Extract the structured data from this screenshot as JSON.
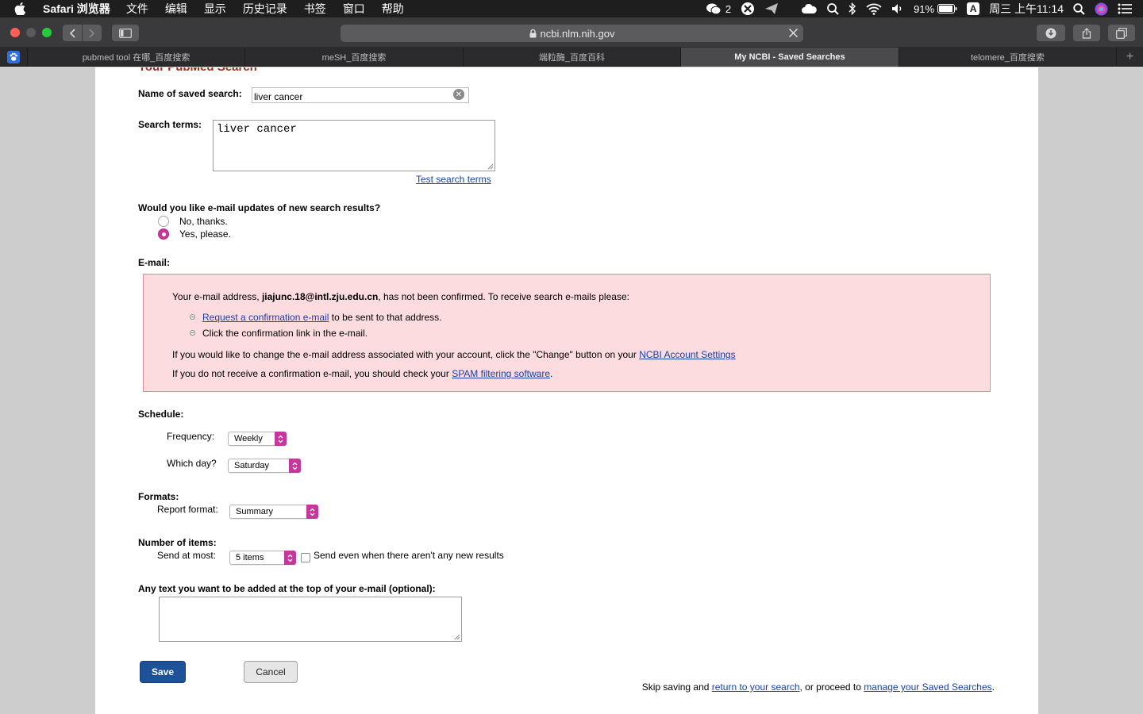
{
  "menubar": {
    "app_name": "Safari 浏览器",
    "items": [
      "文件",
      "编辑",
      "显示",
      "历史记录",
      "书签",
      "窗口",
      "帮助"
    ],
    "wechat_count": "2",
    "battery": "91%",
    "input_method": "A",
    "clock": "周三 上午11:14"
  },
  "browser": {
    "url": "ncbi.nlm.nih.gov",
    "tabs": [
      "pubmed tool 在哪_百度搜索",
      "meSH_百度搜索",
      "端粒酶_百度百科",
      "My NCBI - Saved Searches",
      "telomere_百度搜索"
    ],
    "new_tab_glyph": "+"
  },
  "form": {
    "heading_cut": "Your PubMed Search",
    "name_label": "Name of saved search:",
    "name_value": "liver cancer",
    "terms_label": "Search terms:",
    "terms_value": "liver cancer",
    "test_link": "Test search terms",
    "email_question": "Would you like e-mail updates of new search results?",
    "radio_no": "No, thanks.",
    "radio_yes": "Yes, please.",
    "email_label": "E-mail:",
    "notice": {
      "line1_pre": "Your e-mail address, ",
      "line1_email": "jiajunc.18@intl.zju.edu.cn",
      "line1_post": ", has not been confirmed. To receive search e-mails please:",
      "bullet1_link": "Request a confirmation e-mail",
      "bullet1_post": " to be sent to that address.",
      "bullet2": "Click the confirmation link in the e-mail.",
      "line3_pre": "If you would like to change the e-mail address associated with your account, click the \"Change\" button on your ",
      "line3_link": "NCBI Account Settings",
      "line4_pre": "If you do not receive a confirmation e-mail, you should check your ",
      "line4_link": "SPAM filtering software",
      "line4_post": "."
    },
    "schedule_label": "Schedule:",
    "frequency_label": "Frequency:",
    "frequency_value": "Weekly",
    "day_label": "Which day?",
    "day_value": "Saturday",
    "formats_label": "Formats:",
    "report_label": "Report format:",
    "report_value": "Summary",
    "items_label": "Number of items:",
    "send_label": "Send at most:",
    "send_value": "5 items",
    "send_even_label": "Send even when there aren't any new results",
    "intro_label": "Any text you want to be added at the top of your e-mail (optional):",
    "intro_value": "",
    "save_button": "Save",
    "cancel_button": "Cancel",
    "footer_pre": "Skip saving and ",
    "footer_link1": "return to your search",
    "footer_mid": ", or proceed to ",
    "footer_link2": "manage your Saved Searches",
    "footer_post": "."
  },
  "colors": {
    "accent_magenta": "#c5379b",
    "save_blue": "#1e5298",
    "notice_bg": "#fddcdf",
    "link_blue": "#1a3fa6"
  }
}
